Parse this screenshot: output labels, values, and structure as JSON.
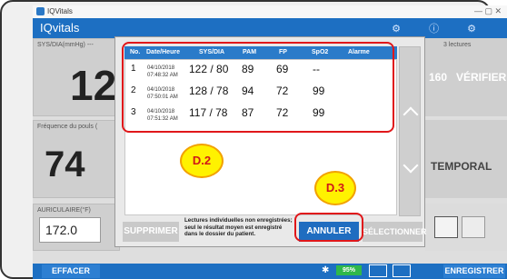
{
  "window": {
    "title": "IQVitals"
  },
  "app": {
    "name": "IQvitals"
  },
  "tiles": {
    "sys_label": "SYS/DIA(mmHg) ---",
    "sys_value": "12",
    "fc_label": "Fréquence du pouls (",
    "fc_value": "74",
    "temp_label": "AURICULAIRE(°F)",
    "temp_value": "172.0",
    "lectures": "3 lectures",
    "count": "160",
    "verifier": "VÉRIFIER",
    "temporal": "TEMPORAL"
  },
  "modal": {
    "headers": {
      "no": "No.",
      "date": "Date/Heure",
      "sysdia": "SYS/DIA",
      "pam": "PAM",
      "fp": "FP",
      "spo2": "SpO2",
      "alarme": "Alarme"
    },
    "rows": [
      {
        "no": "1",
        "date": "04/10/2018",
        "time": "07:48:32 AM",
        "sysdia": "122 / 80",
        "pam": "89",
        "fp": "69",
        "spo2": "--"
      },
      {
        "no": "2",
        "date": "04/10/2018",
        "time": "07:50:01 AM",
        "sysdia": "128 / 78",
        "pam": "94",
        "fp": "72",
        "spo2": "99"
      },
      {
        "no": "3",
        "date": "04/10/2018",
        "time": "07:51:32 AM",
        "sysdia": "117 / 78",
        "pam": "87",
        "fp": "72",
        "spo2": "99"
      }
    ],
    "supprimer": "SUPPRIMER",
    "note": "Lectures individuelles non enregistrées; seul le résultat moyen est enregistré dans le dossier du patient.",
    "annuler": "ANNULER",
    "selectionner": "SÉLECTIONNER"
  },
  "callouts": {
    "d2": "D.2",
    "d3": "D.3"
  },
  "bottom": {
    "effacer": "EFFACER",
    "battery": "95%",
    "enregistrer": "ENREGISTRER"
  },
  "colors": {
    "primary": "#1d6fc2",
    "highlight": "#e0171a",
    "callout_fill": "#fff200"
  }
}
